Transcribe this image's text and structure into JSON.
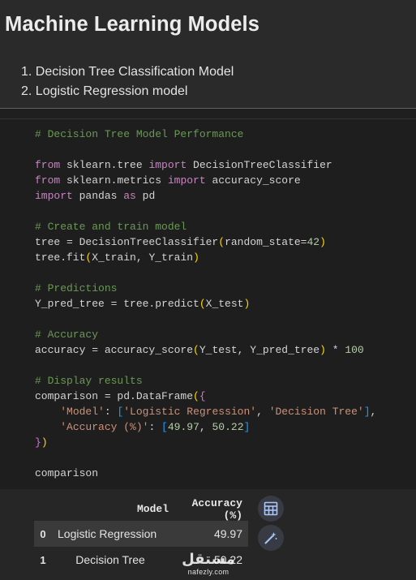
{
  "markdown": {
    "title": "Machine Learning Models",
    "items": [
      "1. Decision Tree Classification Model",
      "2. Logistic Regression model"
    ]
  },
  "code": {
    "lines": [
      [
        {
          "t": "# Decision Tree Model Performance",
          "c": "#6a9955"
        }
      ],
      [],
      [
        {
          "t": "from",
          "c": "#c586c0"
        },
        {
          "t": " sklearn.tree ",
          "c": "#d4d4d4"
        },
        {
          "t": "import",
          "c": "#c586c0"
        },
        {
          "t": " DecisionTreeClassifier",
          "c": "#d4d4d4"
        }
      ],
      [
        {
          "t": "from",
          "c": "#c586c0"
        },
        {
          "t": " sklearn.metrics ",
          "c": "#d4d4d4"
        },
        {
          "t": "import",
          "c": "#c586c0"
        },
        {
          "t": " accuracy_score",
          "c": "#d4d4d4"
        }
      ],
      [
        {
          "t": "import",
          "c": "#c586c0"
        },
        {
          "t": " pandas ",
          "c": "#d4d4d4"
        },
        {
          "t": "as",
          "c": "#c586c0"
        },
        {
          "t": " pd",
          "c": "#d4d4d4"
        }
      ],
      [],
      [
        {
          "t": "# Create and train model",
          "c": "#6a9955"
        }
      ],
      [
        {
          "t": "tree = DecisionTreeClassifier",
          "c": "#d4d4d4"
        },
        {
          "t": "(",
          "c": "#ffd700"
        },
        {
          "t": "random_state=",
          "c": "#d4d4d4"
        },
        {
          "t": "42",
          "c": "#b5cea8"
        },
        {
          "t": ")",
          "c": "#ffd700"
        }
      ],
      [
        {
          "t": "tree.fit",
          "c": "#d4d4d4"
        },
        {
          "t": "(",
          "c": "#ffd700"
        },
        {
          "t": "X_train, Y_train",
          "c": "#d4d4d4"
        },
        {
          "t": ")",
          "c": "#ffd700"
        }
      ],
      [],
      [
        {
          "t": "# Predictions",
          "c": "#6a9955"
        }
      ],
      [
        {
          "t": "Y_pred_tree = tree.predict",
          "c": "#d4d4d4"
        },
        {
          "t": "(",
          "c": "#ffd700"
        },
        {
          "t": "X_test",
          "c": "#d4d4d4"
        },
        {
          "t": ")",
          "c": "#ffd700"
        }
      ],
      [],
      [
        {
          "t": "# Accuracy",
          "c": "#6a9955"
        }
      ],
      [
        {
          "t": "accuracy = accuracy_score",
          "c": "#d4d4d4"
        },
        {
          "t": "(",
          "c": "#ffd700"
        },
        {
          "t": "Y_test, Y_pred_tree",
          "c": "#d4d4d4"
        },
        {
          "t": ")",
          "c": "#ffd700"
        },
        {
          "t": " * ",
          "c": "#d4d4d4"
        },
        {
          "t": "100",
          "c": "#b5cea8"
        }
      ],
      [],
      [
        {
          "t": "# Display results",
          "c": "#6a9955"
        }
      ],
      [
        {
          "t": "comparison = pd.DataFrame",
          "c": "#d4d4d4"
        },
        {
          "t": "(",
          "c": "#ffd700"
        },
        {
          "t": "{",
          "c": "#da70d6"
        }
      ],
      [
        {
          "t": "    ",
          "c": "#d4d4d4"
        },
        {
          "t": "'Model'",
          "c": "#ce9178"
        },
        {
          "t": ": ",
          "c": "#d4d4d4"
        },
        {
          "t": "[",
          "c": "#179fff"
        },
        {
          "t": "'Logistic Regression'",
          "c": "#ce9178"
        },
        {
          "t": ", ",
          "c": "#d4d4d4"
        },
        {
          "t": "'Decision Tree'",
          "c": "#ce9178"
        },
        {
          "t": "]",
          "c": "#179fff"
        },
        {
          "t": ",",
          "c": "#d4d4d4"
        }
      ],
      [
        {
          "t": "    ",
          "c": "#d4d4d4"
        },
        {
          "t": "'Accuracy (%)'",
          "c": "#ce9178"
        },
        {
          "t": ": ",
          "c": "#d4d4d4"
        },
        {
          "t": "[",
          "c": "#179fff"
        },
        {
          "t": "49.97",
          "c": "#b5cea8"
        },
        {
          "t": ", ",
          "c": "#d4d4d4"
        },
        {
          "t": "50.22",
          "c": "#b5cea8"
        },
        {
          "t": "]",
          "c": "#179fff"
        }
      ],
      [
        {
          "t": "}",
          "c": "#da70d6"
        },
        {
          "t": ")",
          "c": "#ffd700"
        }
      ],
      [],
      [
        {
          "t": "comparison",
          "c": "#d4d4d4"
        }
      ]
    ]
  },
  "output": {
    "headers": [
      "",
      "Model",
      "Accuracy (%)"
    ],
    "rows": [
      [
        "0",
        "Logistic Regression",
        "49.97"
      ],
      [
        "1",
        "Decision Tree",
        "50.22"
      ]
    ],
    "buttons": {
      "table_icon": "table-icon",
      "magic_icon": "magic-wand-icon"
    }
  },
  "watermark": {
    "text": "مستقل",
    "url": "nafezly.com"
  }
}
